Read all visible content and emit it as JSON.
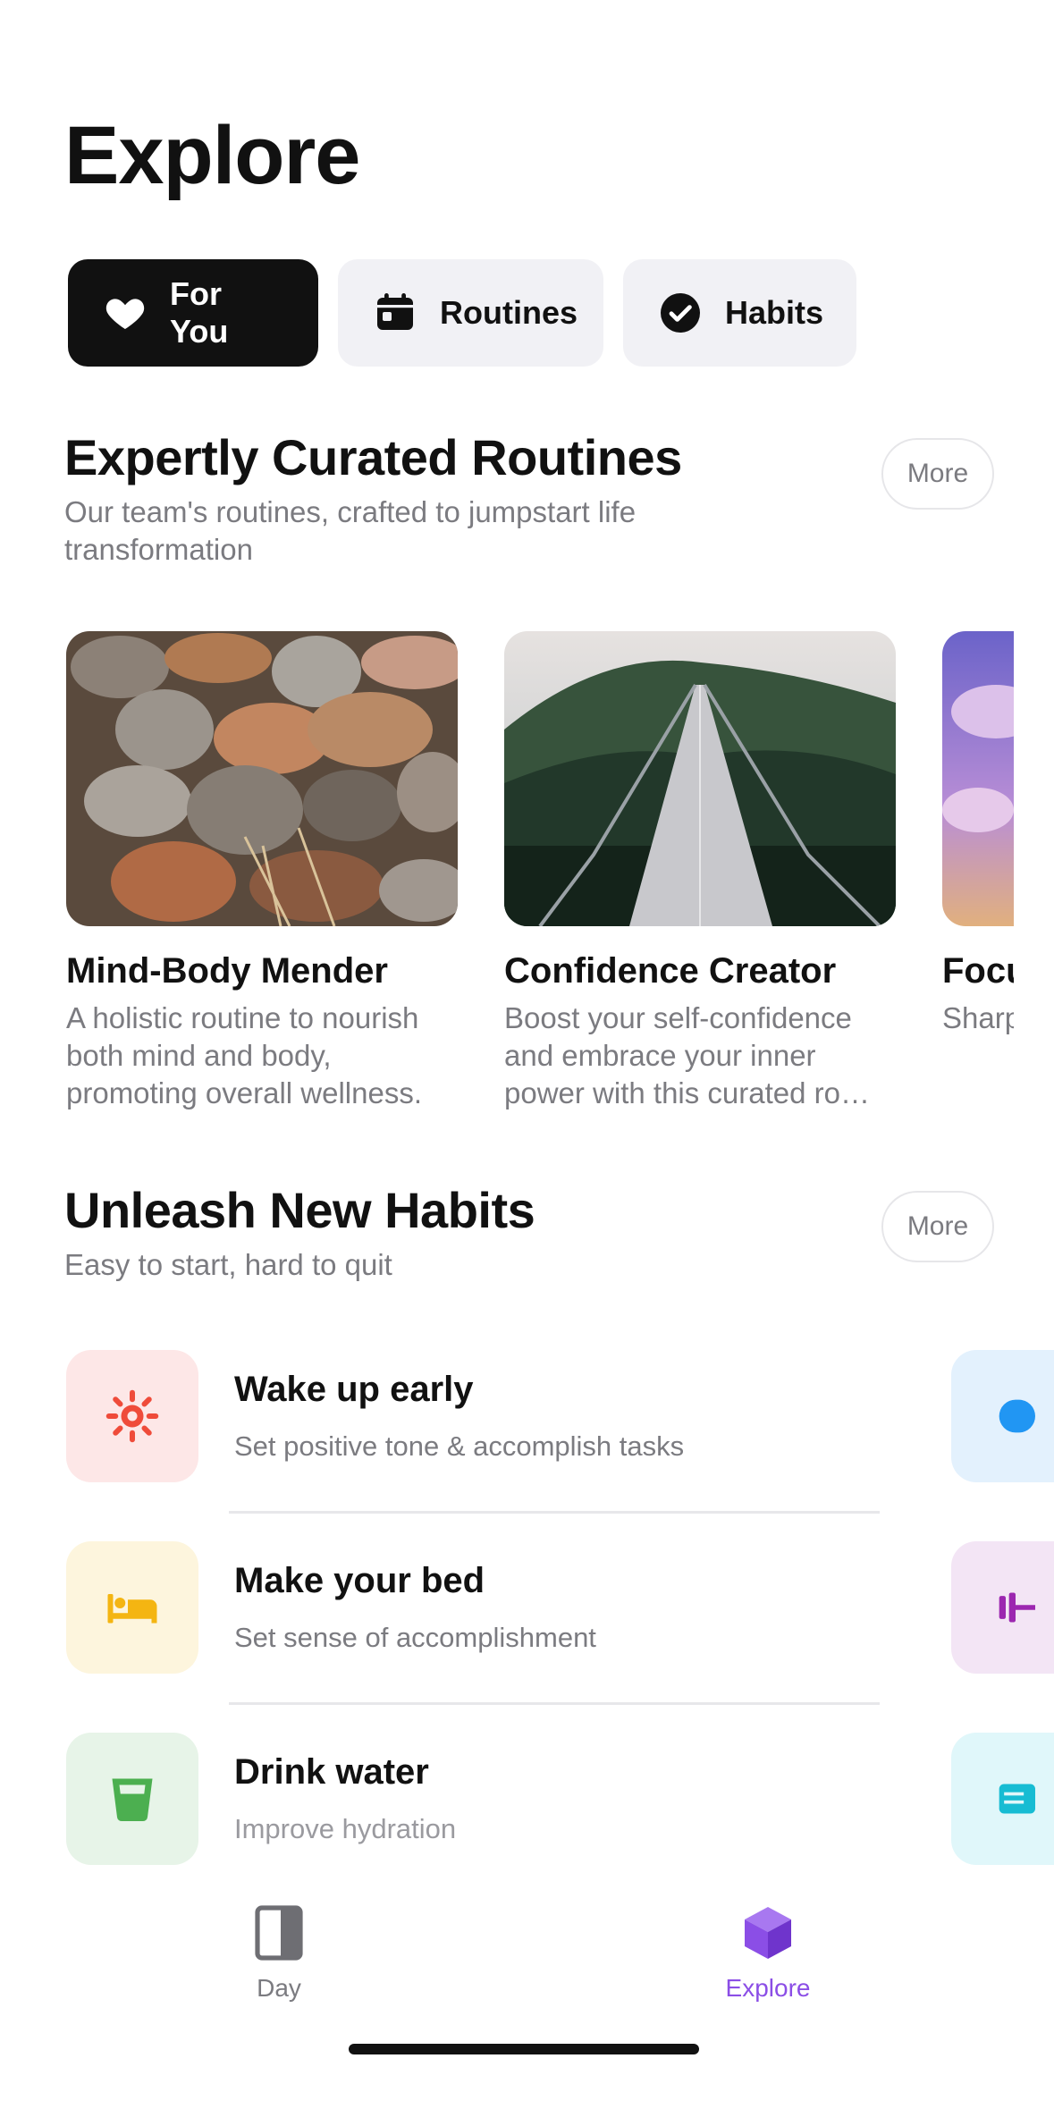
{
  "page": {
    "title": "Explore"
  },
  "tabs": [
    {
      "label": "For You",
      "icon": "heart-icon",
      "active": true
    },
    {
      "label": "Routines",
      "icon": "calendar-icon",
      "active": false
    },
    {
      "label": "Habits",
      "icon": "check-circle-icon",
      "active": false
    }
  ],
  "routines_section": {
    "title": "Expertly Curated Routines",
    "subtitle": "Our team's routines, crafted to jumpstart life transformation",
    "more_label": "More",
    "cards": [
      {
        "title": "Mind-Body Mender",
        "description": "A holistic routine to nourish both mind and body, promoting overall wellness.",
        "image": "rocks-and-leaves"
      },
      {
        "title": "Confidence Creator",
        "description": "Boost your self-confidence and embrace your inner power with this curated ro…",
        "image": "suspension-bridge"
      },
      {
        "title": "Focu",
        "description": "Sharp produ exper",
        "image": "purple-sky"
      }
    ]
  },
  "habits_section": {
    "title": "Unleash New Habits",
    "subtitle": "Easy to start, hard to quit",
    "more_label": "More",
    "items": [
      {
        "title": "Wake up early",
        "subtitle": "Set positive tone & accomplish tasks",
        "icon": "sun-icon",
        "color": "#ef4b3a",
        "tile_bg": "#fde7e7"
      },
      {
        "title": "Make your bed",
        "subtitle": "Set sense of accomplishment",
        "icon": "bed-icon",
        "color": "#f4b512",
        "tile_bg": "#fdf5dd"
      },
      {
        "title": "Drink water",
        "subtitle": "Improve hydration",
        "icon": "glass-icon",
        "color": "#4caf50",
        "tile_bg": "#e7f4e8"
      }
    ],
    "side_tiles": [
      {
        "icon": "partial-blue-icon",
        "color": "#2196f3",
        "tile_bg": "#e3f1fd"
      },
      {
        "icon": "dumbbell-icon",
        "color": "#9c27b0",
        "tile_bg": "#f3e5f5"
      },
      {
        "icon": "book-icon",
        "color": "#17bcd3",
        "tile_bg": "#e0f7fa"
      }
    ]
  },
  "tabbar": {
    "items": [
      {
        "label": "Day",
        "icon": "book-open-icon",
        "active": false
      },
      {
        "label": "Explore",
        "icon": "cube-icon",
        "active": true
      }
    ],
    "accent": "#8b4ee6"
  }
}
